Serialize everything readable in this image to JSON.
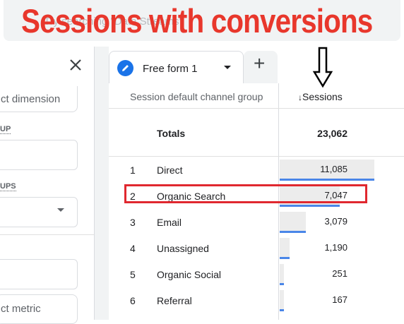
{
  "search": {
    "placeholder": "Try searching \"Data Streams\""
  },
  "annotation": {
    "headline": "Sessions with conversions"
  },
  "left_panel": {
    "dimension_button": "ct dimension",
    "label_up": "UP",
    "label_ups": "UPS",
    "metric_button": "ct metric"
  },
  "tabs": [
    {
      "label": "Free form 1"
    }
  ],
  "add_tab_symbol": "+",
  "table": {
    "columns": [
      "Session default channel group",
      "Sessions"
    ],
    "sort_icon": "↓",
    "totals_label": "Totals",
    "totals_value": "23,062",
    "rows": [
      {
        "rank": "1",
        "channel": "Direct",
        "sessions": "11,085",
        "fraction": 1.0
      },
      {
        "rank": "2",
        "channel": "Organic Search",
        "sessions": "7,047",
        "fraction": 0.636
      },
      {
        "rank": "3",
        "channel": "Email",
        "sessions": "3,079",
        "fraction": 0.278
      },
      {
        "rank": "4",
        "channel": "Unassigned",
        "sessions": "1,190",
        "fraction": 0.107
      },
      {
        "rank": "5",
        "channel": "Organic Social",
        "sessions": "251",
        "fraction": 0.023
      },
      {
        "rank": "6",
        "channel": "Referral",
        "sessions": "167",
        "fraction": 0.015
      }
    ]
  },
  "colors": {
    "accent": "#1a73e8",
    "annotation_red": "#e0282f",
    "bar_line": "#4a86e8"
  }
}
